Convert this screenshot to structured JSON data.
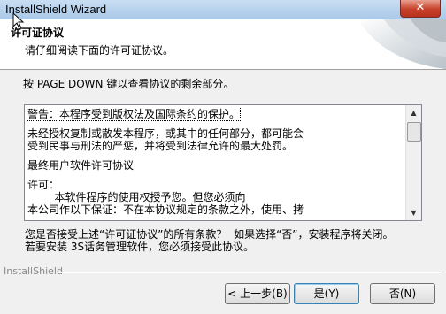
{
  "window": {
    "title": "InstallShield Wizard",
    "close_glyph": "✕"
  },
  "header": {
    "title": "许可证协议",
    "subtitle": "请仔细阅读下面的许可证协议。"
  },
  "instruction": "按 PAGE DOWN 键以查看协议的剩余部分。",
  "license": {
    "lines": [
      "警告：本程序受到版权法及国际条约的保护。",
      "未经授权复制或散发本程序，或其中的任何部分，都可能会",
      "受到民事与刑法的严惩，并将受到法律允许的最大处罚。",
      "最终用户软件许可协议",
      "许可：",
      "        本软件程序的使用权授予您。但您必须向",
      "本公司作以下保证：不在本协议规定的条款之外，使用、拷"
    ]
  },
  "question": {
    "line1": "您是否接受上述“许可证协议”的所有条款？  如果选择“否”，安装程序将关闭。",
    "line2": "若要安装 3S话务管理软件，您必须接受此协议。"
  },
  "brand": "InstallShield",
  "buttons": {
    "back": "< 上一步(B)",
    "yes": "是(Y)",
    "no": "否(N)"
  },
  "icons": {
    "up": "▲",
    "down": "▼"
  }
}
